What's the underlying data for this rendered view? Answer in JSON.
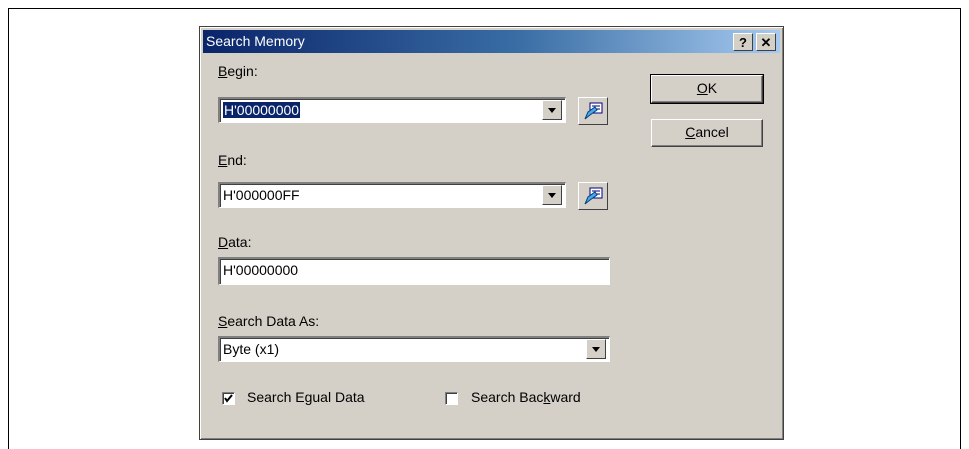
{
  "dialog": {
    "title": "Search Memory",
    "help_glyph": "?",
    "close_glyph": "✕"
  },
  "begin": {
    "label_u": "B",
    "label_rest": "egin:",
    "value": "H'00000000",
    "icon": "address-picker-icon"
  },
  "end": {
    "label_u": "E",
    "label_rest": "nd:",
    "value": "H'000000FF",
    "icon": "address-picker-icon"
  },
  "data": {
    "label_u": "D",
    "label_rest": "ata:",
    "value": "H'00000000"
  },
  "search_as": {
    "label_u": "S",
    "label_rest": "earch Data As:",
    "selected": "Byte (x1)"
  },
  "options": {
    "equal": {
      "label_pre": "Search E",
      "label_u": "g",
      "label_post": "ual Data",
      "checked": true
    },
    "backward": {
      "label_pre": "Search Bac",
      "label_u": "k",
      "label_post": "ward",
      "checked": false
    }
  },
  "buttons": {
    "ok_u": "O",
    "ok_rest": "K",
    "cancel_u": "C",
    "cancel_rest": "ancel"
  },
  "colors": {
    "title_start": "#0a246a",
    "title_end": "#a6caf0",
    "face": "#d4d0c8",
    "selection": "#0a246a"
  }
}
